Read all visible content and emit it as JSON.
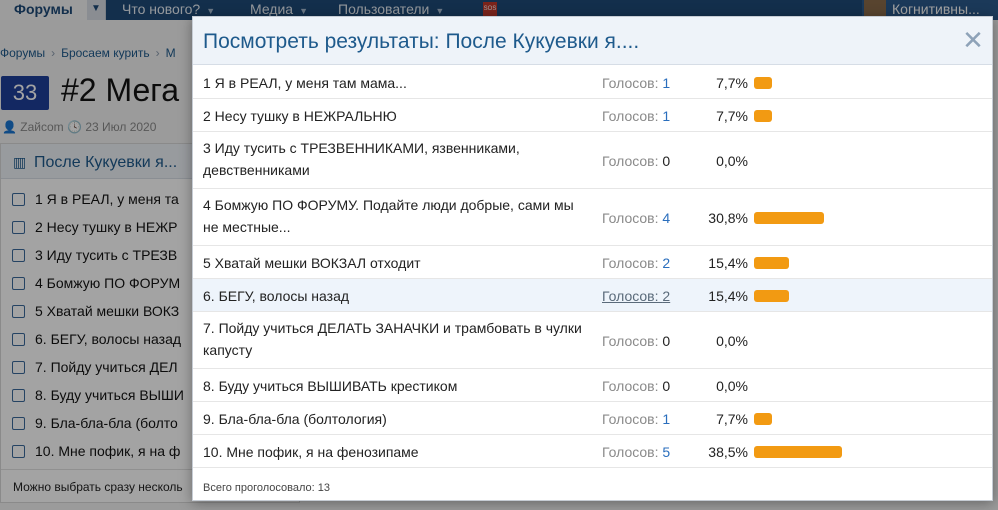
{
  "nav": {
    "forums": "Форумы",
    "items": [
      "Что нового?",
      "Медиа",
      "Пользователи"
    ],
    "sos": "SOS",
    "user_name": "Когнитивны..."
  },
  "breadcrumb": {
    "items": [
      "Форумы",
      "Бросаем курить",
      "М"
    ]
  },
  "thread": {
    "badge": "33",
    "title": "#2 Мега",
    "author": "Zaйcom",
    "date": "23 Июл 2020"
  },
  "poll_bg": {
    "title": "После Кукуевки я...",
    "options": [
      "1 Я в РЕАЛ, у меня та",
      "2 Несу тушку в НЕЖР",
      "3 Иду тусить с ТРЕЗВ",
      "4 Бомжую ПО ФОРУМ",
      "5 Хватай мешки ВОКЗ",
      "6. БЕГУ, волосы назад",
      "7. Пойду учиться ДЕЛ",
      "8. Буду учиться ВЫШИ",
      "9. Бла-бла-бла (болто",
      "10. Мне пофик, я на ф"
    ],
    "footer": "Можно выбрать сразу несколь"
  },
  "modal": {
    "title": "Посмотреть результаты: После Кукуевки я....",
    "votes_label": "Голосов:",
    "rows": [
      {
        "text": "1 Я в РЕАЛ, у меня там мама...",
        "votes": 1,
        "percent": "7,7%",
        "share": 7.7
      },
      {
        "text": "2 Несу тушку в НЕЖРАЛЬНЮ",
        "votes": 1,
        "percent": "7,7%",
        "share": 7.7
      },
      {
        "text": "3 Иду тусить с ТРЕЗВЕННИКАМИ, язвенниками, девственниками",
        "votes": 0,
        "percent": "0,0%",
        "share": 0
      },
      {
        "text": "4 Бомжую ПО ФОРУМУ. Подайте люди добрые, сами мы не местные...",
        "votes": 4,
        "percent": "30,8%",
        "share": 30.8
      },
      {
        "text": "5 Хватай мешки ВОКЗАЛ отходит",
        "votes": 2,
        "percent": "15,4%",
        "share": 15.4
      },
      {
        "text": "6. БЕГУ, волосы назад",
        "votes": 2,
        "percent": "15,4%",
        "share": 15.4
      },
      {
        "text": "7. Пойду учиться ДЕЛАТЬ ЗАНАЧКИ и трамбовать в чулки капусту",
        "votes": 0,
        "percent": "0,0%",
        "share": 0
      },
      {
        "text": "8. Буду учиться ВЫШИВАТЬ крестиком",
        "votes": 0,
        "percent": "0,0%",
        "share": 0
      },
      {
        "text": "9. Бла-бла-бла (болтология)",
        "votes": 1,
        "percent": "7,7%",
        "share": 7.7
      },
      {
        "text": "10. Мне пофик, я на фенозипаме",
        "votes": 5,
        "percent": "38,5%",
        "share": 38.5
      }
    ],
    "footer": "Всего проголосовало: 13"
  },
  "colors": {
    "accent": "#1e5a8c",
    "bar": "#f29a12",
    "nav": "#1e4a78",
    "badge": "#1e3f9a"
  }
}
